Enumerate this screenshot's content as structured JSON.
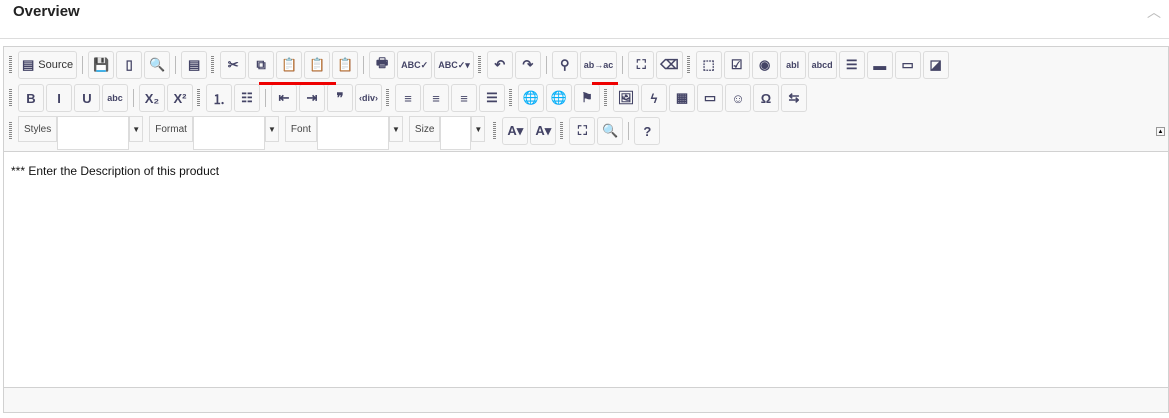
{
  "header": {
    "title": "Overview",
    "collapse_icon": "chevron-up-icon"
  },
  "toolbar": {
    "row1": [
      {
        "t": "grip"
      },
      {
        "name": "source",
        "glyph": "▤",
        "label": "Source"
      },
      {
        "t": "sep"
      },
      {
        "name": "save",
        "glyph": "💾"
      },
      {
        "name": "new-page",
        "glyph": "▯"
      },
      {
        "name": "preview",
        "glyph": "🔍"
      },
      {
        "t": "sep"
      },
      {
        "name": "templates",
        "glyph": "▤"
      },
      {
        "t": "grip"
      },
      {
        "name": "cut",
        "glyph": "✂"
      },
      {
        "name": "copy",
        "glyph": "⧉"
      },
      {
        "name": "paste",
        "glyph": "📋"
      },
      {
        "name": "paste-text",
        "glyph": "📋"
      },
      {
        "name": "paste-from-word",
        "glyph": "📋"
      },
      {
        "t": "sep"
      },
      {
        "name": "print",
        "glyph": "🖶"
      },
      {
        "name": "spell-check",
        "glyph": "ABC✓"
      },
      {
        "name": "spell-check-as-you-type",
        "glyph": "ABC✓▾"
      },
      {
        "t": "grip"
      },
      {
        "name": "undo",
        "glyph": "↶"
      },
      {
        "name": "redo",
        "glyph": "↷"
      },
      {
        "t": "sep"
      },
      {
        "name": "find",
        "glyph": "⚲"
      },
      {
        "name": "replace",
        "glyph": "ab→ac"
      },
      {
        "t": "sep"
      },
      {
        "name": "select-all",
        "glyph": "⛶"
      },
      {
        "name": "remove-format",
        "glyph": "⌫"
      },
      {
        "t": "grip"
      },
      {
        "name": "form",
        "glyph": "⬚"
      },
      {
        "name": "checkbox",
        "glyph": "☑"
      },
      {
        "name": "radio",
        "glyph": "◉"
      },
      {
        "name": "text-field",
        "glyph": "abl"
      },
      {
        "name": "textarea",
        "glyph": "abcd"
      },
      {
        "name": "select-field",
        "glyph": "☰"
      },
      {
        "name": "form-button",
        "glyph": "▬"
      },
      {
        "name": "image-button",
        "glyph": "▭"
      },
      {
        "name": "hidden-field",
        "glyph": "◪"
      }
    ],
    "row2": [
      {
        "t": "grip"
      },
      {
        "name": "bold",
        "glyph": "B"
      },
      {
        "name": "italic",
        "glyph": "I"
      },
      {
        "name": "underline",
        "glyph": "U"
      },
      {
        "name": "strikethrough",
        "glyph": "abc"
      },
      {
        "t": "sep"
      },
      {
        "name": "subscript",
        "glyph": "X₂"
      },
      {
        "name": "superscript",
        "glyph": "X²"
      },
      {
        "t": "grip"
      },
      {
        "name": "numbered-list",
        "glyph": "⒈"
      },
      {
        "name": "bulleted-list",
        "glyph": "☷"
      },
      {
        "t": "sep"
      },
      {
        "name": "outdent",
        "glyph": "⇤"
      },
      {
        "name": "indent",
        "glyph": "⇥"
      },
      {
        "name": "blockquote",
        "glyph": "❞"
      },
      {
        "name": "create-div",
        "glyph": "‹div›"
      },
      {
        "t": "grip"
      },
      {
        "name": "align-left",
        "glyph": "≡"
      },
      {
        "name": "align-center",
        "glyph": "≡"
      },
      {
        "name": "align-right",
        "glyph": "≡"
      },
      {
        "name": "justify",
        "glyph": "☰"
      },
      {
        "t": "grip"
      },
      {
        "name": "link",
        "glyph": "🌐"
      },
      {
        "name": "unlink",
        "glyph": "🌐"
      },
      {
        "name": "anchor",
        "glyph": "⚑"
      },
      {
        "t": "grip"
      },
      {
        "name": "image",
        "glyph": "🖼"
      },
      {
        "name": "flash",
        "glyph": "ϟ"
      },
      {
        "name": "table",
        "glyph": "▦"
      },
      {
        "name": "horizontal-line",
        "glyph": "▭"
      },
      {
        "name": "smiley",
        "glyph": "☺"
      },
      {
        "name": "special-char",
        "glyph": "Ω"
      },
      {
        "name": "page-break",
        "glyph": "⇆"
      }
    ],
    "combos": [
      {
        "name": "styles",
        "label": "Styles",
        "w": 72
      },
      {
        "name": "format",
        "label": "Format",
        "w": 72
      },
      {
        "name": "font",
        "label": "Font",
        "w": 72
      },
      {
        "name": "size",
        "label": "Size",
        "w": 31
      }
    ],
    "row3": [
      {
        "t": "grip"
      },
      {
        "name": "text-color",
        "glyph": "A▾"
      },
      {
        "name": "background-color",
        "glyph": "A▾"
      },
      {
        "t": "grip"
      },
      {
        "name": "maximize",
        "glyph": "⛶"
      },
      {
        "name": "show-blocks",
        "glyph": "🔍"
      },
      {
        "t": "sep"
      },
      {
        "name": "about",
        "glyph": "?"
      }
    ],
    "collapse_icon": "collapse-toolbar-icon"
  },
  "content": {
    "text": "*** Enter the Description of this product"
  },
  "colors": {
    "highlight_underline": "#e00000"
  }
}
